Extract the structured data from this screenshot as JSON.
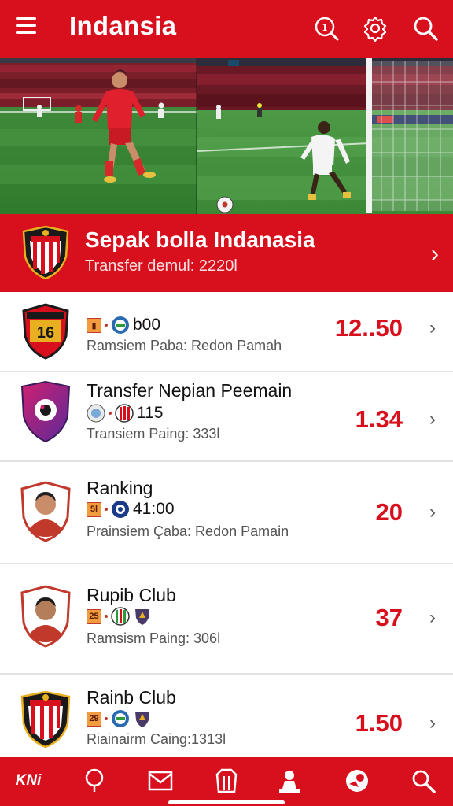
{
  "app": {
    "title": "Indansia"
  },
  "topbar_icons": [
    "info-search-icon",
    "settings-icon",
    "search-icon"
  ],
  "featured": {
    "title": "Sepak bolla Indanasia",
    "subtitle": "Transfer demul: 2220l"
  },
  "items": [
    {
      "title": "",
      "meta_text": "b00",
      "subtitle": "Ramsiem Paba: Redon Pamah",
      "value": "12..50"
    },
    {
      "title": "Transfer Nepian Peemain",
      "meta_text": "115",
      "subtitle": "Transiem Paing: 333l",
      "value": "1.34"
    },
    {
      "title": "Ranking",
      "meta_text": "41:00",
      "subtitle": "Prainsiem Çaba: Redon Pamain",
      "value": "20"
    },
    {
      "title": "Rupib Club",
      "meta_text": "",
      "subtitle": "Ramsism Paing: 306l",
      "value": "37"
    },
    {
      "title": "Rainb Club",
      "meta_text": "",
      "subtitle": "Riainairm Caing:1313l",
      "value": "1.50"
    }
  ],
  "badges": {
    "item0": "16",
    "item3": "25",
    "item4": "29",
    "item2": "5l"
  },
  "bottom_nav": {
    "logo": "KNi"
  },
  "colors": {
    "primary": "#d8101e",
    "value": "#d8101e"
  }
}
